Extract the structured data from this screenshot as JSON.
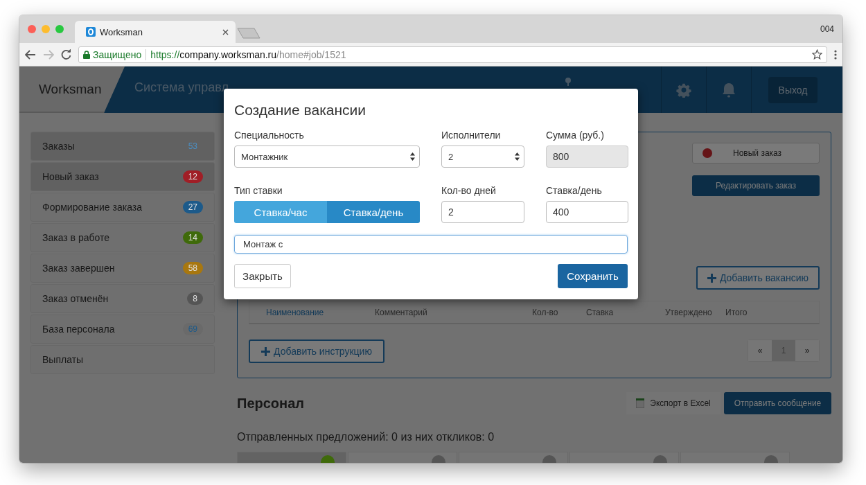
{
  "browser": {
    "tab_title": "Worksman",
    "corner_label": "004",
    "security_label": "Защищено",
    "url_scheme": "https://",
    "url_host": "company.worksman.ru",
    "url_path": "/home#job/1521"
  },
  "header": {
    "logo": "Worksman",
    "title": "Система управл",
    "logout": "Выход"
  },
  "sidebar": {
    "items": [
      {
        "label": "Заказы",
        "count": "53",
        "selected": true,
        "color": "#4a8fc4",
        "kind": "plain"
      },
      {
        "label": "Новый заказ",
        "count": "12",
        "selected": true,
        "color": "#a01e26",
        "kind": "pill"
      },
      {
        "label": "Формирование заказа",
        "count": "27",
        "selected": false,
        "color": "#1c5a8a",
        "kind": "pill"
      },
      {
        "label": "Заказ в работе",
        "count": "14",
        "selected": false,
        "color": "#3f6a0a",
        "kind": "pill"
      },
      {
        "label": "Заказ завершен",
        "count": "58",
        "selected": false,
        "color": "#a8770f",
        "kind": "pill"
      },
      {
        "label": "Заказ отменён",
        "count": "8",
        "selected": false,
        "color": "#555555",
        "kind": "pill"
      },
      {
        "label": "База персонала",
        "count": "69",
        "selected": false,
        "color": "#1c5a8a",
        "kind": "soft"
      },
      {
        "label": "Выплаты",
        "selected": false
      }
    ]
  },
  "order": {
    "new_order_button": "Новый заказ",
    "edit_button": "Редактировать заказ",
    "add_vacancy_button": "Добавить вакансию",
    "table": {
      "columns": [
        "Наименование",
        "Комментарий",
        "Кол-во",
        "Ставка",
        "Утверждено",
        "Итого"
      ]
    },
    "add_instruction_button": "Добавить инструкцию",
    "pagination": {
      "prev": "«",
      "pages": [
        {
          "label": "1",
          "selected": true
        }
      ],
      "next": "»"
    }
  },
  "personnel": {
    "title": "Персонал",
    "export_button": "Экспорт в Excel",
    "send_button": "Отправить сообщение",
    "summary": "Отправленных предложений: 0 из них откликов: 0",
    "tabs": [
      {
        "selected": true,
        "color": "#3f6a0a"
      },
      {
        "selected": false,
        "color": "#555555"
      },
      {
        "selected": false,
        "color": "#555555"
      },
      {
        "selected": false,
        "color": "#555555"
      },
      {
        "selected": false,
        "color": "#555555"
      }
    ]
  },
  "modal": {
    "title": "Создание вакансии",
    "specialty": {
      "label": "Специальность",
      "value": "Монтажник"
    },
    "performers": {
      "label": "Исполнители",
      "value": "2"
    },
    "sum": {
      "label": "Сумма (руб.)",
      "value": "800",
      "disabled": true
    },
    "rate_type": {
      "label": "Тип ставки",
      "options": [
        {
          "label": "Ставка/час",
          "selected": false
        },
        {
          "label": "Ставка/день",
          "selected": true
        }
      ]
    },
    "days": {
      "label": "Кол-во дней",
      "value": "2"
    },
    "daily_rate": {
      "label": "Ставка/день",
      "value": "400"
    },
    "comment": {
      "value": "Монтаж с",
      "focused": true
    },
    "close_button": "Закрыть",
    "save_button": "Сохранить"
  }
}
